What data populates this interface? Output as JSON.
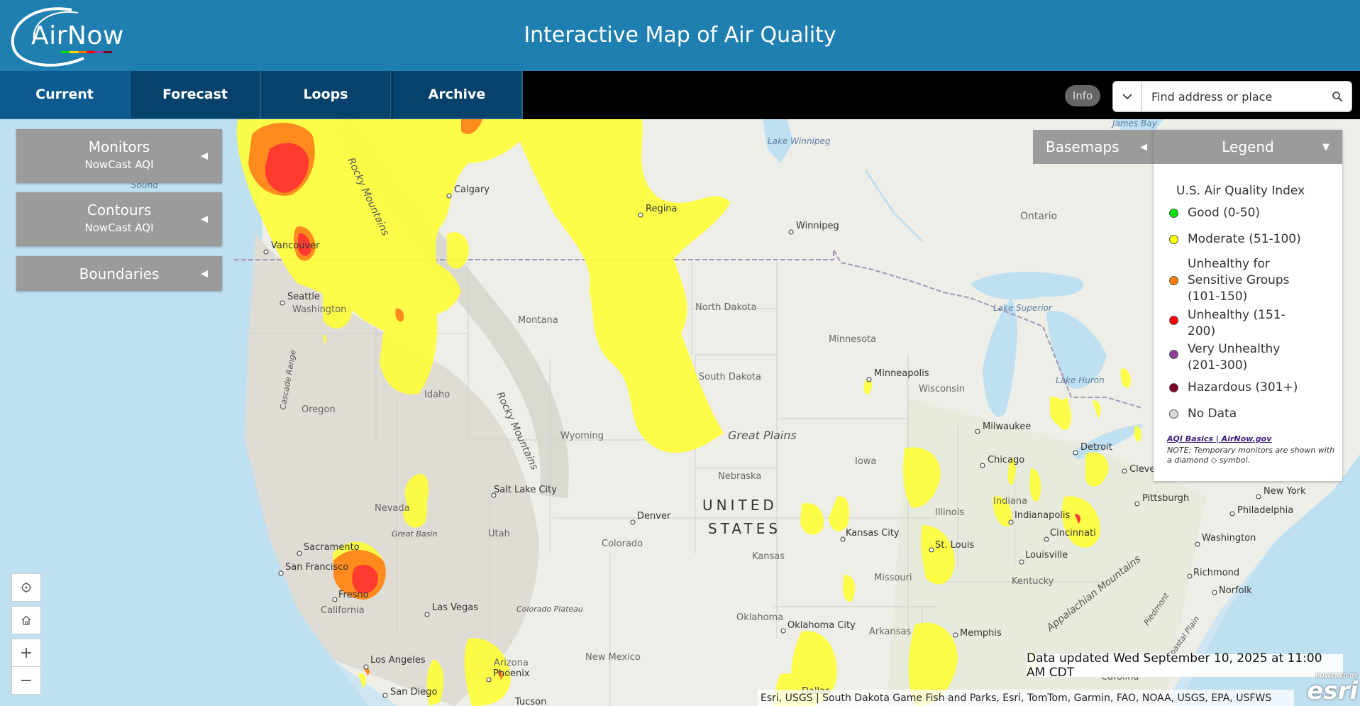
{
  "header": {
    "logo_text": "AirNow",
    "title": "Interactive Map of Air Quality"
  },
  "nav": {
    "tabs": [
      {
        "label": "Current"
      },
      {
        "label": "Forecast"
      },
      {
        "label": "Loops"
      },
      {
        "label": "Archive"
      }
    ],
    "info_label": "Info",
    "search_placeholder": "Find address or place"
  },
  "panels": {
    "monitors": {
      "title": "Monitors",
      "subtitle": "NowCast AQI"
    },
    "contours": {
      "title": "Contours",
      "subtitle": "NowCast AQI"
    },
    "boundaries": {
      "title": "Boundaries"
    }
  },
  "basemaps_label": "Basemaps",
  "legend": {
    "header": "Legend",
    "title": "U.S. Air Quality Index",
    "items": [
      {
        "lines": [
          "Good (0-50)"
        ],
        "color": "#00e400"
      },
      {
        "lines": [
          "Moderate (51-100)"
        ],
        "color": "#ffff00"
      },
      {
        "lines": [
          "Unhealthy for",
          "Sensitive Groups",
          "(101-150)"
        ],
        "color": "#ff7e00"
      },
      {
        "lines": [
          "Unhealthy (151-",
          "200)"
        ],
        "color": "#ff0000"
      },
      {
        "lines": [
          "Very Unhealthy",
          "(201-300)"
        ],
        "color": "#8f3f97"
      },
      {
        "lines": [
          "Hazardous (301+)"
        ],
        "color": "#7e0023"
      },
      {
        "lines": [
          "No Data"
        ],
        "color": "#d9d9d9"
      }
    ],
    "link": "AQI Basics | AirNow.gov",
    "note": "NOTE: Temporary monitors are shown with a diamond ◇ symbol."
  },
  "map": {
    "updated": "Data updated Wed September 10, 2025 at 11:00 AM CDT",
    "attribution": "Esri, USGS | South Dakota Game Fish and Parks, Esri, TomTom, Garmin, FAO, NOAA, USGS, EPA, USFWS",
    "esri_powered": "POWERED BY",
    "esri_logo": "esri",
    "country_line1": "UNITED",
    "country_line2": "STATES",
    "cities": [
      "Calgary",
      "Regina",
      "Winnipeg",
      "Vancouver",
      "Seattle",
      "Minneapolis",
      "Milwaukee",
      "Chicago",
      "Detroit",
      "Cleveland",
      "Pittsburgh",
      "New York",
      "Philadelphia",
      "Washington",
      "Richmond",
      "Norfolk",
      "Salt Lake City",
      "Denver",
      "Kansas City",
      "St. Louis",
      "Indianapolis",
      "Cincinnati",
      "Louisville",
      "Sacramento",
      "San Francisco",
      "Fresno",
      "Las Vegas",
      "Los Angeles",
      "San Diego",
      "Phoenix",
      "Tucson",
      "Oklahoma City",
      "Memphis",
      "Dallas"
    ],
    "regions": [
      "Washington",
      "Oregon",
      "Idaho",
      "Montana",
      "Wyoming",
      "Nevada",
      "Utah",
      "Colorado",
      "California",
      "Arizona",
      "New Mexico",
      "North Dakota",
      "South Dakota",
      "Nebraska",
      "Kansas",
      "Oklahoma",
      "Minnesota",
      "Iowa",
      "Missouri",
      "Arkansas",
      "Wisconsin",
      "Illinois",
      "Indiana",
      "Kentucky",
      "Carolina",
      "Ontario"
    ],
    "features": [
      "Lake Winnipeg",
      "Lake Superior",
      "Lake Huron",
      "James Bay",
      "Rocky Mountains",
      "Rocky Mountains",
      "Great Plains",
      "Great Basin",
      "Colorado Plateau",
      "Cascade Range",
      "Appalachian Mountains",
      "Piedmont",
      "Coastal Plain",
      "Sound"
    ]
  }
}
